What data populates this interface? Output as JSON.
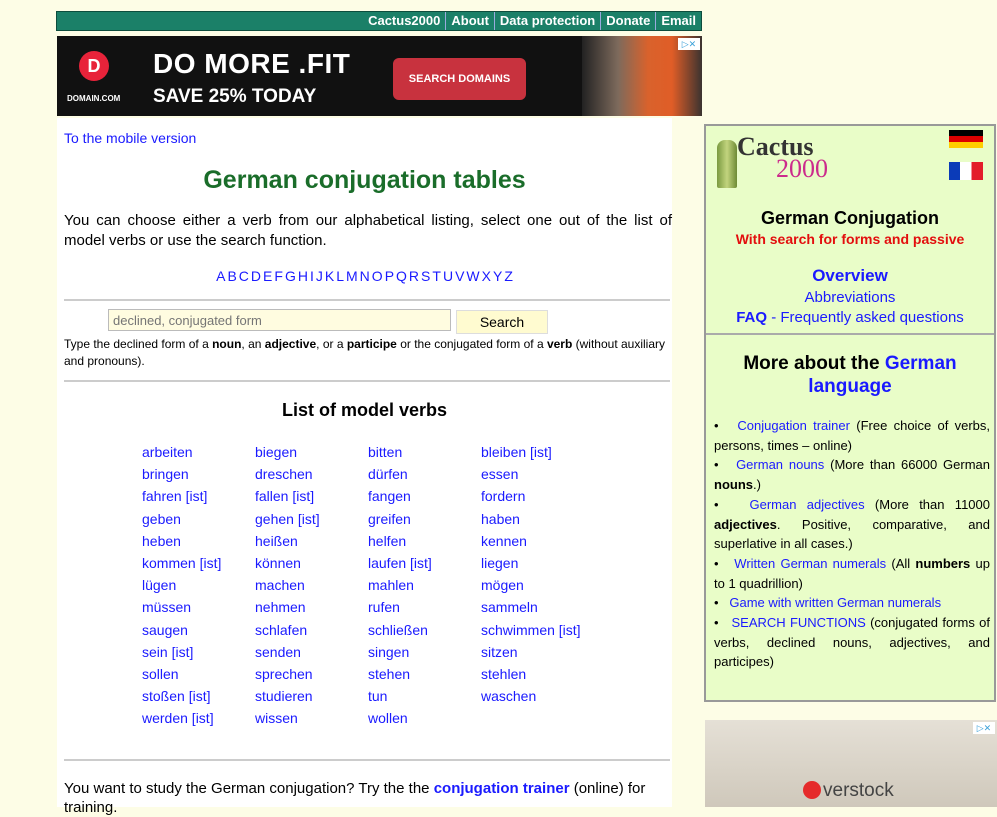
{
  "nav": {
    "items": [
      "Cactus2000",
      "About",
      "Data protection",
      "Donate",
      "Email"
    ]
  },
  "ad_banner": {
    "brand": "DOMAIN.COM",
    "headline": "DO MORE .FIT",
    "subline": "SAVE 25% TODAY",
    "cta": "SEARCH DOMAINS",
    "adchoice": "▷✕"
  },
  "main": {
    "mobile_link": "To the mobile version",
    "title": "German conjugation tables",
    "intro": "You can choose either a verb from our alphabetical listing, select one out of the list of model verbs or use the search function.",
    "alphabet": [
      "A",
      "B",
      "C",
      "D",
      "E",
      "F",
      "G",
      "H",
      "I",
      "J",
      "K",
      "L",
      "M",
      "N",
      "O",
      "P",
      "Q",
      "R",
      "S",
      "T",
      "U",
      "V",
      "W",
      "X",
      "Y",
      "Z"
    ],
    "search": {
      "placeholder": "declined, conjugated form",
      "button": "Search"
    },
    "search_help": {
      "t1": "Type the declined form of a ",
      "b1": "noun",
      "t2": ", an ",
      "b2": "adjective",
      "t3": ", or a ",
      "b3": "participe",
      "t4": " or the conjugated form of a ",
      "b4": "verb",
      "t5": " (without auxiliary and pronouns)."
    },
    "verbs_title": "List of model verbs",
    "verbs": [
      "arbeiten",
      "biegen",
      "bitten",
      "bleiben [ist]",
      "bringen",
      "dreschen",
      "dürfen",
      "essen",
      "fahren [ist]",
      "fallen [ist]",
      "fangen",
      "fordern",
      "geben",
      "gehen [ist]",
      "greifen",
      "haben",
      "heben",
      "heißen",
      "helfen",
      "kennen",
      "kommen [ist]",
      "können",
      "laufen [ist]",
      "liegen",
      "lügen",
      "machen",
      "mahlen",
      "mögen",
      "müssen",
      "nehmen",
      "rufen",
      "sammeln",
      "saugen",
      "schlafen",
      "schließen",
      "schwimmen [ist]",
      "sein [ist]",
      "senden",
      "singen",
      "sitzen",
      "sollen",
      "sprechen",
      "stehen",
      "stehlen",
      "stoßen [ist]",
      "studieren",
      "tun",
      "waschen",
      "werden [ist]",
      "wissen",
      "wollen",
      ""
    ],
    "study": {
      "t1": "You want to study the German conjugation? Try the the ",
      "link": "conjugation trainer",
      "t2": " (online) for training."
    }
  },
  "sidebar": {
    "logo_word": "Cactus",
    "logo_num": "2000",
    "title": "German Conjugation",
    "subtitle": "With search for forms and passive",
    "overview": "Overview",
    "abbreviations": "Abbreviations",
    "faq": "FAQ",
    "faq_rest": " - Frequently asked questions",
    "more_title": "More about the ",
    "more_link": "German language",
    "list": [
      {
        "link": "Conjugation trainer",
        "pre": "",
        "bold": "",
        "post": " (Free choice of verbs, persons, times – online)"
      },
      {
        "link": "German nouns",
        "pre": " (More than 66000 German ",
        "bold": "nouns",
        "post": ".)"
      },
      {
        "link": "German adjectives",
        "pre": " (More than 11000 ",
        "bold": "adjectives",
        "post": ". Positive, comparative, and superlative in all cases.)"
      },
      {
        "link": "Written German numerals",
        "pre": " (All ",
        "bold": "numbers",
        "post": " up to 1 quadrillion)"
      },
      {
        "link": "Game with written German numerals",
        "pre": "",
        "bold": "",
        "post": ""
      },
      {
        "link": "SEARCH FUNCTIONS",
        "pre": "",
        "bold": "",
        "post": " (conjugated forms of verbs, declined nouns, adjectives, and participes)"
      }
    ]
  },
  "bottom_ad": {
    "brand": "verstock",
    "adchoice": "▷✕"
  }
}
